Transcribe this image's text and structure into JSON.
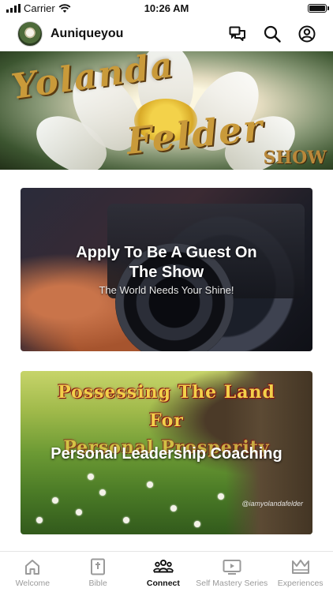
{
  "status_bar": {
    "carrier": "Carrier",
    "time": "10:26 AM",
    "icons": [
      "signal-icon",
      "wifi-icon",
      "battery-icon"
    ]
  },
  "header": {
    "title": "Auniqueyou",
    "icons": [
      "chat-icon",
      "search-icon",
      "profile-icon"
    ]
  },
  "hero": {
    "line1": "Yolanda",
    "line2": "Felder",
    "line3": "SHOW"
  },
  "cards": [
    {
      "title": "Apply To Be A Guest On The Show",
      "subtitle": "The World Needs Your Shine!"
    },
    {
      "graphic_line1": "Possessing The Land",
      "graphic_line2": "For",
      "graphic_line3": "Personal Prosperity",
      "title": "Personal Leadership Coaching",
      "watermark": "@iamyolandafelder"
    }
  ],
  "tabs": [
    {
      "label": "Welcome",
      "icon": "home-icon",
      "active": false
    },
    {
      "label": "Bible",
      "icon": "bible-icon",
      "active": false
    },
    {
      "label": "Connect",
      "icon": "group-icon",
      "active": true
    },
    {
      "label": "Self Mastery Series",
      "icon": "video-icon",
      "active": false
    },
    {
      "label": "Experiences",
      "icon": "crown-icon",
      "active": false
    }
  ],
  "colors": {
    "active_tab": "#111111",
    "inactive_tab": "#9a9a9a",
    "hero_gold": "#c99a3a"
  }
}
